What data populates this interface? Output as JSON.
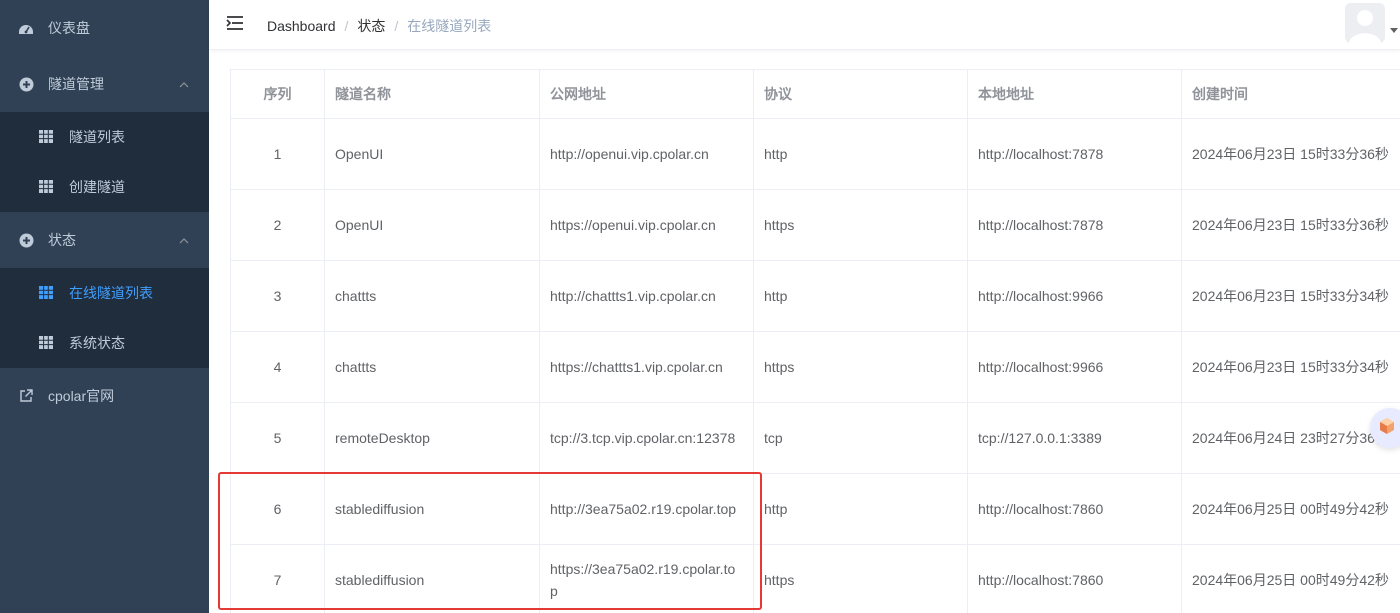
{
  "sidebar": {
    "dashboard": {
      "label": "仪表盘",
      "icon": "dashboard-icon"
    },
    "tunnel_mgmt": {
      "label": "隧道管理",
      "icon": "circle-plus-icon",
      "items": [
        {
          "label": "隧道列表",
          "icon": "grid-icon"
        },
        {
          "label": "创建隧道",
          "icon": "grid-icon"
        }
      ]
    },
    "status": {
      "label": "状态",
      "icon": "circle-plus-icon",
      "items": [
        {
          "label": "在线隧道列表",
          "icon": "grid-icon",
          "active": true
        },
        {
          "label": "系统状态",
          "icon": "grid-icon"
        }
      ]
    },
    "website": {
      "label": "cpolar官网",
      "icon": "external-link-icon"
    }
  },
  "header": {
    "breadcrumb": [
      "Dashboard",
      "状态",
      "在线隧道列表"
    ],
    "separator": "/"
  },
  "table": {
    "columns": [
      "序列",
      "隧道名称",
      "公网地址",
      "协议",
      "本地地址",
      "创建时间"
    ],
    "rows": [
      [
        "1",
        "OpenUI",
        "http://openui.vip.cpolar.cn",
        "http",
        "http://localhost:7878",
        "2024年06月23日 15时33分36秒"
      ],
      [
        "2",
        "OpenUI",
        "https://openui.vip.cpolar.cn",
        "https",
        "http://localhost:7878",
        "2024年06月23日 15时33分36秒"
      ],
      [
        "3",
        "chattts",
        "http://chattts1.vip.cpolar.cn",
        "http",
        "http://localhost:9966",
        "2024年06月23日 15时33分34秒"
      ],
      [
        "4",
        "chattts",
        "https://chattts1.vip.cpolar.cn",
        "https",
        "http://localhost:9966",
        "2024年06月23日 15时33分34秒"
      ],
      [
        "5",
        "remoteDesktop",
        "tcp://3.tcp.vip.cpolar.cn:12378",
        "tcp",
        "tcp://127.0.0.1:3389",
        "2024年06月24日 23时27分36秒"
      ],
      [
        "6",
        "stablediffusion",
        "http://3ea75a02.r19.cpolar.top",
        "http",
        "http://localhost:7860",
        "2024年06月25日 00时49分42秒"
      ],
      [
        "7",
        "stablediffusion",
        "https://3ea75a02.r19.cpolar.top",
        "https",
        "http://localhost:7860",
        "2024年06月25日 00时49分42秒"
      ]
    ]
  },
  "colors": {
    "sidebar_bg": "#304156",
    "submenu_bg": "#1f2d3d",
    "active": "#409eff",
    "highlight": "#e53935"
  }
}
